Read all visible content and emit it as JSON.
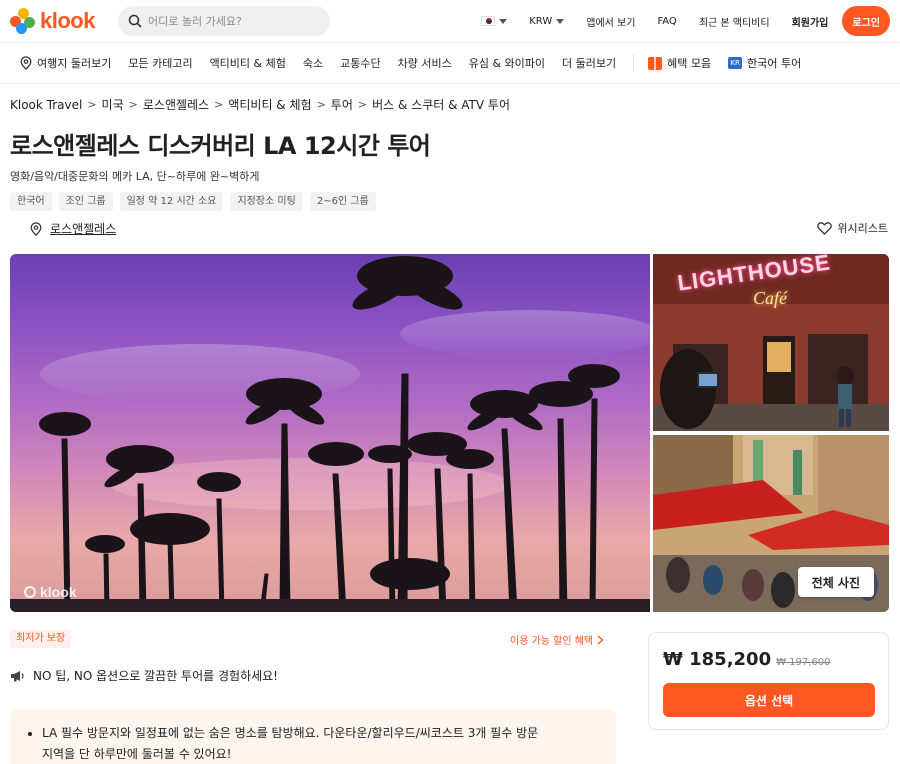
{
  "header": {
    "logo_text": "klook",
    "search_placeholder": "어디로 놀러 가세요?",
    "currency": "KRW",
    "app_label": "앱에서 보기",
    "faq_label": "FAQ",
    "recent_label": "최근 본 액티비티",
    "signup_label": "회원가입",
    "login_label": "로그인"
  },
  "nav": {
    "items": [
      "여행지 둘러보기",
      "모든 카테고리",
      "액티비티 & 체험",
      "숙소",
      "교통수단",
      "차량 서비스",
      "유심 & 와이파이",
      "더 둘러보기"
    ],
    "benefits_label": "혜택 모음",
    "korean_tour_label": "한국어 투어",
    "kr_badge": "KR"
  },
  "breadcrumb": [
    "Klook Travel",
    "미국",
    "로스앤젤레스",
    "액티비티 & 체험",
    "투어",
    "버스 & 스쿠터 & ATV 투어"
  ],
  "activity": {
    "title": "로스앤젤레스 디스커버리 LA 12시간 투어",
    "subtitle": "영화/음악/대중문화의 메카 LA, 단~하루에 완~벽하게",
    "tags": [
      "한국어",
      "조인 그룹",
      "일정 약 12 시간 소요",
      "지정장소 미팅",
      "2~6인 그룹"
    ],
    "location": "로스앤젤레스",
    "wishlist_label": "위시리스트",
    "watermark": "klook",
    "all_photos_label": "전체 사진",
    "lighthouse_sign": "LIGHTHOUSE",
    "lighthouse_sub": "Café"
  },
  "promo": {
    "lowest_price_badge": "최저가 보장",
    "discount_link": "이용 가능 할인 혜택",
    "notice": "NO 팁, NO 옵션으로 깔끔한 투어를 경험하세요!",
    "highlights": [
      "LA 필수 방문지와 일정표에 없는 숨은 명소를 탐방해요. 다운타운/할리우드/씨코스트 3개 필수 방문 지역을 단 하루만에 둘러볼 수 있어요!"
    ]
  },
  "pricing": {
    "price": "₩ 185,200",
    "original_price": "₩ 197,600",
    "select_label": "옵션 선택"
  },
  "colors": {
    "brand": "#ff5722",
    "text": "#212121"
  }
}
